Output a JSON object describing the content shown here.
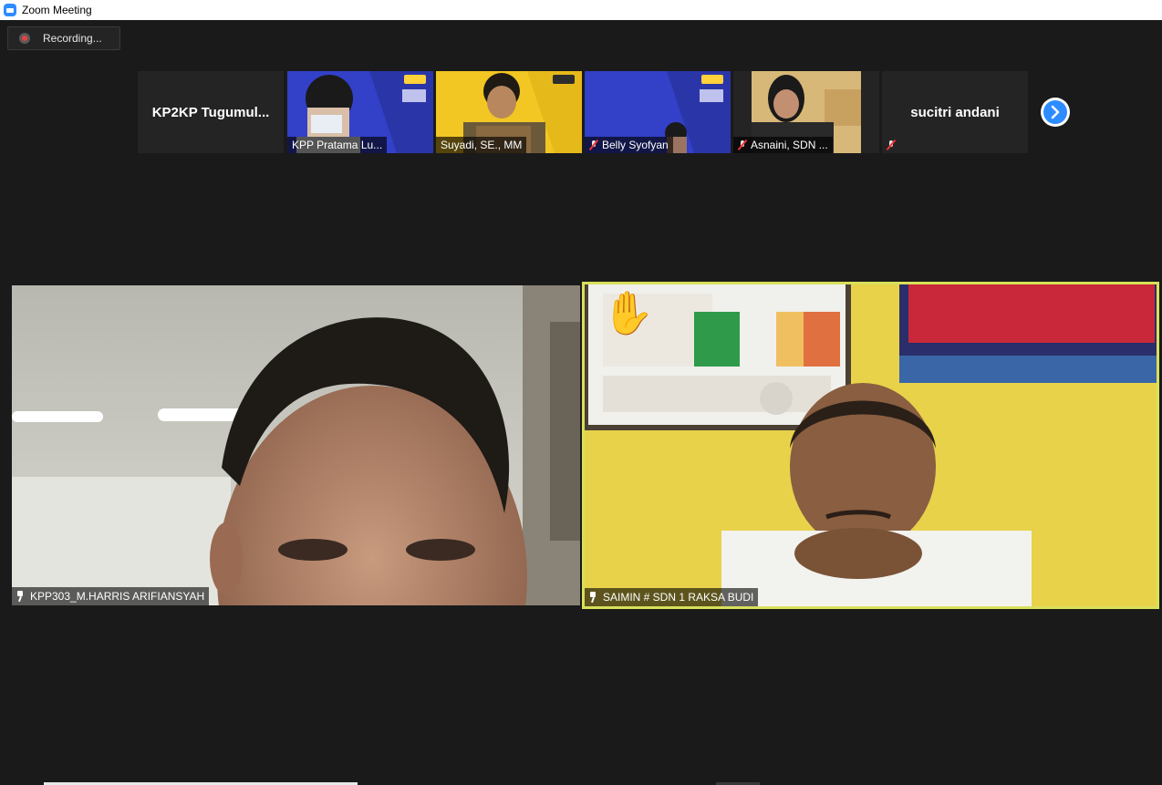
{
  "window": {
    "title": "Zoom Meeting",
    "app_icon": "zoom-icon"
  },
  "recording": {
    "label": "Recording...",
    "icon": "record-dot-icon",
    "dot_color": "#e84040"
  },
  "gallery": {
    "tiles": [
      {
        "name": "KP2KP  Tugumul...",
        "kind": "text"
      },
      {
        "name": "KPP Pratama Lu...",
        "kind": "video",
        "muted": false
      },
      {
        "name": "Suyadi, SE., MM",
        "kind": "video",
        "muted": false
      },
      {
        "name": "Belly Syofyan",
        "kind": "video",
        "muted": true
      },
      {
        "name": "Asnaini, SDN ...",
        "kind": "video",
        "muted": true
      },
      {
        "name": "sucitri andani",
        "kind": "text",
        "muted": true
      }
    ],
    "next_icon": "chevron-right-icon"
  },
  "videos": {
    "left": {
      "label": "KPP303_M.HARRIS ARIFIANSYAH",
      "pinned": true
    },
    "right": {
      "label": "SAIMIN # SDN 1 RAKSA BUDI",
      "pinned": true,
      "raised_hand": "✋",
      "active_speaker_color": "#d8e05a"
    }
  }
}
